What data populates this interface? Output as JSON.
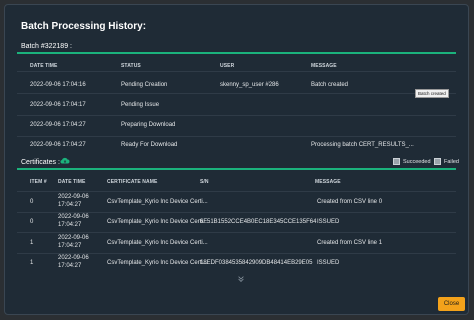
{
  "modal": {
    "title": "Batch Processing History:",
    "batch_label": "Batch #322189 :",
    "close_label": "Close"
  },
  "history": {
    "headers": [
      "DATE TIME",
      "STATUS",
      "USER",
      "MESSAGE"
    ],
    "rows": [
      {
        "datetime": "2022-09-06 17:04:16",
        "status": "Pending Creation",
        "user": "skenny_sp_user #286",
        "message": "Batch created"
      },
      {
        "datetime": "2022-09-06 17:04:17",
        "status": "Pending Issue",
        "user": "",
        "message": ""
      },
      {
        "datetime": "2022-09-06 17:04:27",
        "status": "Preparing Download",
        "user": "",
        "message": ""
      },
      {
        "datetime": "2022-09-06 17:04:27",
        "status": "Ready For Download",
        "user": "",
        "message": "Processing batch CERT_RESULTS_..."
      }
    ],
    "tooltip": "Batch created"
  },
  "certificates": {
    "title": "Certificates :",
    "legend_succeeded": "Succeeded",
    "legend_failed": "Failed",
    "headers": [
      "ITEM #",
      "DATE TIME",
      "CERTIFICATE NAME",
      "S/N",
      "MESSAGE"
    ],
    "rows": [
      {
        "item": "0",
        "date": "2022-09-06",
        "time": "17:04:27",
        "name": "CsvTemplate_Kyrio Inc Device Certi...",
        "sn": "",
        "message": "Created from CSV line 0"
      },
      {
        "item": "0",
        "date": "2022-09-06",
        "time": "17:04:27",
        "name": "CsvTemplate_Kyrio Inc Device Certi...",
        "sn": "6F51B1552CCE4B0EC18E345CCE135F64",
        "message": "ISSUED"
      },
      {
        "item": "1",
        "date": "2022-09-06",
        "time": "17:04:27",
        "name": "CsvTemplate_Kyrio Inc Device Certi...",
        "sn": "",
        "message": "Created from CSV line 1"
      },
      {
        "item": "1",
        "date": "2022-09-06",
        "time": "17:04:27",
        "name": "CsvTemplate_Kyrio Inc Device Certi...",
        "sn": "18EDF0384535842909DB48414EB29E05",
        "message": "ISSUED"
      }
    ]
  },
  "colors": {
    "accent": "#1bb27c",
    "close_button": "#f3a21b",
    "background": "#1f2b36"
  },
  "icons": {
    "cloud": "cloud-download-icon",
    "more": "chevron-down-icon"
  }
}
